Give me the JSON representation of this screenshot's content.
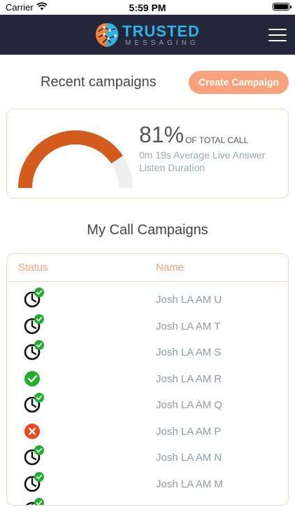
{
  "status_bar": {
    "carrier": "Carrier",
    "time": "5:59 PM"
  },
  "header": {
    "logo_title": "TRUSTED",
    "logo_subtitle": "MESSAGING"
  },
  "recent": {
    "title": "Recent campaigns",
    "create_button": "Create Campaign",
    "percent_value": 81,
    "percent_text": "81%",
    "percent_label": "OF TOTAL CALL",
    "average_text": "0m 19s Average Live Answer Listen Duration"
  },
  "campaigns": {
    "title": "My Call Campaigns",
    "columns": {
      "status": "Status",
      "name": "Name"
    },
    "rows": [
      {
        "status": "scheduled-complete",
        "name": "Josh LA AM U"
      },
      {
        "status": "scheduled-complete",
        "name": "Josh LA AM T"
      },
      {
        "status": "scheduled-complete",
        "name": "Josh LA AM S"
      },
      {
        "status": "complete",
        "name": "Josh LA AM R"
      },
      {
        "status": "scheduled-complete",
        "name": "Josh LA AM Q"
      },
      {
        "status": "failed",
        "name": "Josh LA AM P"
      },
      {
        "status": "scheduled-complete",
        "name": "Josh LA AM N"
      },
      {
        "status": "scheduled-complete",
        "name": "Josh LA AM M"
      },
      {
        "status": "scheduled-complete",
        "name": ""
      }
    ]
  },
  "colors": {
    "header_bg": "#24263a",
    "accent": "#f7a27a",
    "gauge_fill": "#d35b1e",
    "gauge_track": "#eeeeee",
    "success": "#1fae2e",
    "error": "#f0451e"
  },
  "icons": {
    "wifi": "wifi-icon",
    "battery": "battery-icon",
    "menu": "hamburger-menu-icon",
    "clock": "clock-icon",
    "check": "check-icon",
    "cross": "cross-icon"
  }
}
